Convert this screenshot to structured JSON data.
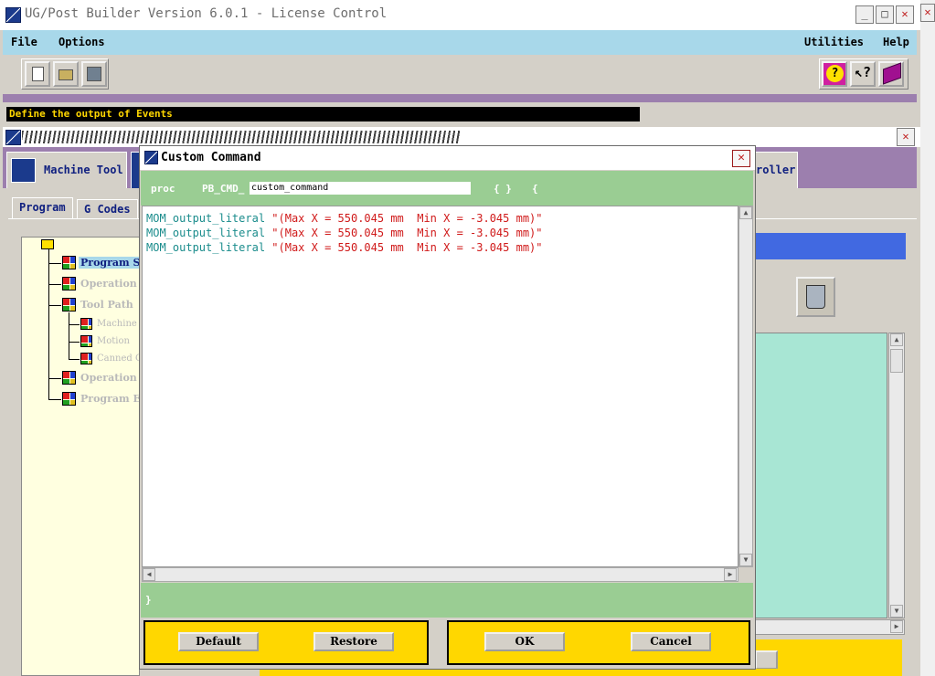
{
  "main_window": {
    "title": "UG/Post Builder Version 6.0.1 - License Control",
    "menu": {
      "file": "File",
      "options": "Options",
      "utilities": "Utilities",
      "help": "Help"
    },
    "status": "Define the output of Events"
  },
  "sub_window": {
    "tabs": {
      "machine_tool": "Machine Tool",
      "controller_fragment": "roller"
    },
    "subtabs": {
      "program": "Program",
      "g_codes": "G Codes"
    },
    "tree": [
      "Program S",
      "Operation",
      "Tool Path",
      "Machine",
      "Motion",
      "Canned C",
      "Operation",
      "Program E"
    ]
  },
  "dialog": {
    "title": "Custom Command",
    "proc_keyword": "proc",
    "proc_prefix": "PB_CMD_",
    "proc_name": "custom_command",
    "brace_glyphs": "{ }",
    "open_brace": "{",
    "close_brace": "}",
    "code_lines": [
      {
        "fn": "MOM_output_literal",
        "arg": "\"(Max X = 550.045 mm  Min X = -3.045 mm)\""
      },
      {
        "fn": "MOM_output_literal",
        "arg": "\"(Max X = 550.045 mm  Min X = -3.045 mm)\""
      },
      {
        "fn": "MOM_output_literal",
        "arg": "\"(Max X = 550.045 mm  Min X = -3.045 mm)\""
      }
    ],
    "buttons": {
      "default": "Default",
      "restore": "Restore",
      "ok": "OK",
      "cancel": "Cancel"
    }
  },
  "colors": {
    "menu_bar": "#a8d8ea",
    "accent_purple": "#9c7fae",
    "dialog_green": "#9acd93",
    "button_yellow": "#ffd700",
    "code_function": "#1a8c8c",
    "code_string": "#d01a1a"
  }
}
